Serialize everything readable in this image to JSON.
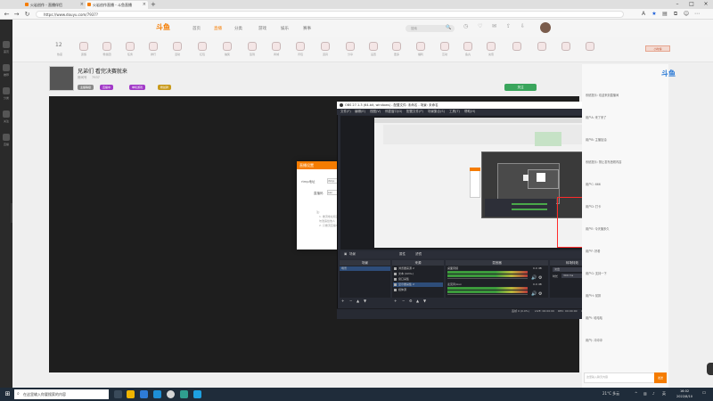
{
  "browser": {
    "tabs": [
      {
        "label": "火岩创作 - 直播伴侣",
        "active": false
      },
      {
        "label": "火岩创作直播 - 斗鱼直播",
        "active": true
      }
    ],
    "address": "https://www.douyu.com/7937?",
    "back_icon": "back-arrow",
    "refresh_icon": "refresh",
    "new_tab": "+"
  },
  "sidebar": {
    "items": [
      "首页",
      "推荐",
      "分类",
      "关注",
      "直播"
    ]
  },
  "site": {
    "logo": "斗鱼",
    "nav": [
      "首页",
      "直播",
      "分类",
      "游戏",
      "娱乐",
      "赛事"
    ],
    "search_placeholder": "搜索",
    "search_button": "🔍"
  },
  "gifts": {
    "items": [
      "12",
      "热度",
      "贵族",
      "粉丝团",
      "任务",
      "排行",
      "活动",
      "红包",
      "抽奖",
      "签到",
      "商城",
      "背包",
      "道具",
      "分享",
      "设置",
      "更多",
      "福利",
      "互动",
      "鱼丸",
      "充值",
      "小时榜"
    ]
  },
  "room": {
    "title": "兄弟们 看完决赛就来",
    "subtitle_1": "房间号",
    "subtitle_2": "7937",
    "tags": [
      "主播等级",
      "直播中",
      "单机游戏",
      "粉丝牌"
    ],
    "follow": "关注"
  },
  "dialog": {
    "title": "直播设置",
    "label_1": "rtmp地址",
    "label_2": "直播码",
    "value_1": "rtmp",
    "value_2": "sec",
    "help_1": "注:",
    "help_2": "1. 推流地址和直播码请",
    "help_3": "勿泄露给他人",
    "help_4": "2. 只推流直播中"
  },
  "obs": {
    "title": "OBS 27.1.3 (64-bit, windows) - 配置文件: 未命名 - 场景: 未命名",
    "menus": [
      "文件(F)",
      "编辑(E)",
      "视图(V)",
      "停靠窗口(D)",
      "配置文件(P)",
      "场景集合(S)",
      "工具(T)",
      "帮助(H)"
    ],
    "scene_bar": [
      "场景",
      "属性",
      "滤镜"
    ],
    "scene_label": "场景",
    "docks": [
      "场景",
      "来源",
      "混音器",
      "转场特效",
      "控件"
    ],
    "scene_items": [
      "场景"
    ],
    "sources": [
      {
        "name": "浏览器来源 2",
        "selected": false
      },
      {
        "name": "文本 (GDI+)",
        "selected": false
      },
      {
        "name": "窗口采集",
        "selected": false
      },
      {
        "name": "显示器采集 2",
        "selected": true
      },
      {
        "name": "媒体源",
        "selected": false
      }
    ],
    "mixer": [
      {
        "name": "桌面音频",
        "db": "0.0 dB"
      },
      {
        "name": "麦克风/Aux",
        "db": "0.0 dB"
      }
    ],
    "transition": {
      "type": "淡出",
      "duration_label": "时长",
      "duration": "300 ms"
    },
    "controls": [
      "停止推流",
      "开始录制",
      "启动虚拟摄像机",
      "工作室模式",
      "设置",
      "退出"
    ],
    "status": {
      "dropped": "丢帧 0 (0.0%)",
      "live": "LIVE: 00:00:00",
      "rec": "REC: 00:00:00",
      "cpu": "CPU: 3.9%, 30.00 fps",
      "kbps": "kb/s: 0"
    }
  },
  "chat": {
    "lines": [
      "系统提示: 欢迎来到直播间",
      "用户A: 来了来了",
      "用户B: 主播加油",
      "系统提示: 禁止发布违规内容",
      "用户C: 666",
      "用户D: 打卡",
      "用户E: 今天播多久",
      "用户F: 好看",
      "用户G: 支持一下",
      "用户H: 前排",
      "用户I: 哈哈哈",
      "用户J: 冲冲冲"
    ],
    "input_placeholder": "这里输入聊天内容",
    "send": "发送"
  },
  "taskbar": {
    "search_placeholder": "在这里输入你要搜索的内容",
    "weather": "21°C 多云",
    "lang": "英",
    "time": "16:02",
    "date": "2022/8/10"
  }
}
